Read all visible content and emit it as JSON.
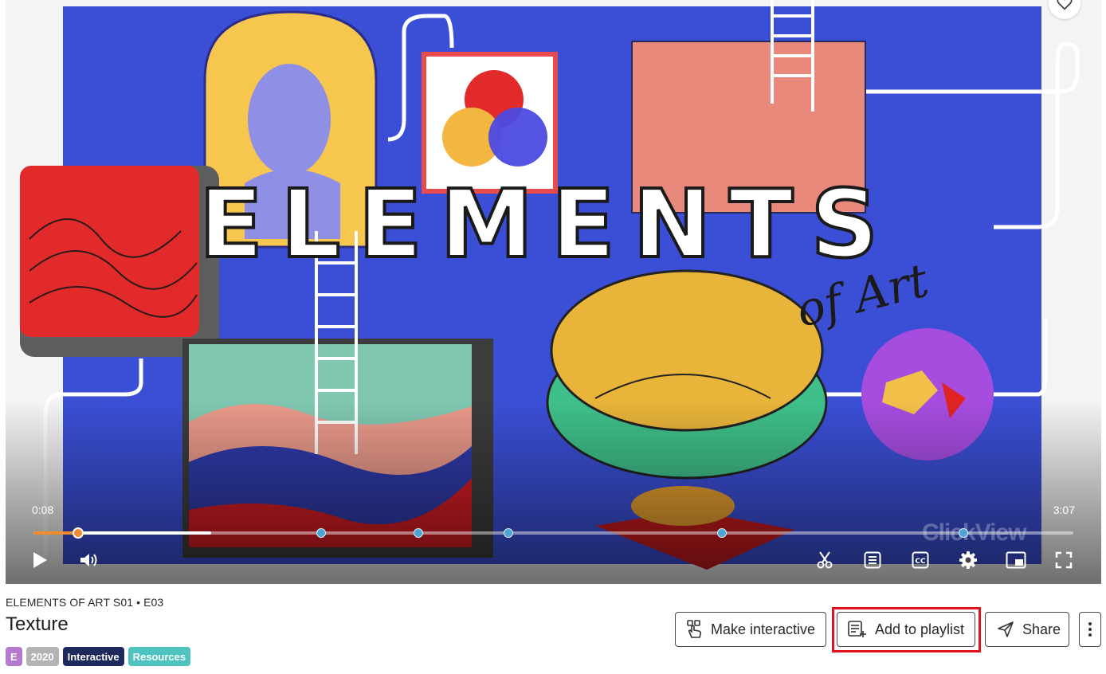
{
  "player": {
    "current_time": "0:08",
    "duration": "3:07",
    "played_fraction": 0.043,
    "buffered_fraction": 0.171,
    "chapter_marker_fractions": [
      0.277,
      0.37,
      0.457,
      0.662,
      0.894
    ],
    "watermark": "ClickView",
    "colors": {
      "progress": "#f08c2b",
      "chapter_marker": "#4ba3d6"
    },
    "controls": {
      "play": "play-icon",
      "volume": "volume-icon",
      "clip": "scissors-icon",
      "transcript": "transcript-icon",
      "captions": "closed-captions-icon",
      "settings": "gear-icon",
      "picture_in_picture": "picture-in-picture-icon",
      "fullscreen": "fullscreen-icon"
    },
    "frame_title": "ELEMENTS",
    "frame_subtitle": "of Art"
  },
  "video": {
    "series_line": "ELEMENTS OF ART S01 • E03",
    "title": "Texture",
    "badges": [
      {
        "label": "E",
        "color": "#b57ad0"
      },
      {
        "label": "2020",
        "color": "#b3b3b3"
      },
      {
        "label": "Interactive",
        "color": "#1f2a5c"
      },
      {
        "label": "Resources",
        "color": "#4fc3bf"
      }
    ]
  },
  "actions": {
    "make_interactive": "Make interactive",
    "add_to_playlist": "Add to playlist",
    "share": "Share",
    "more_icon": "vertical-dots-icon",
    "highlight_color": "#e0141e"
  }
}
